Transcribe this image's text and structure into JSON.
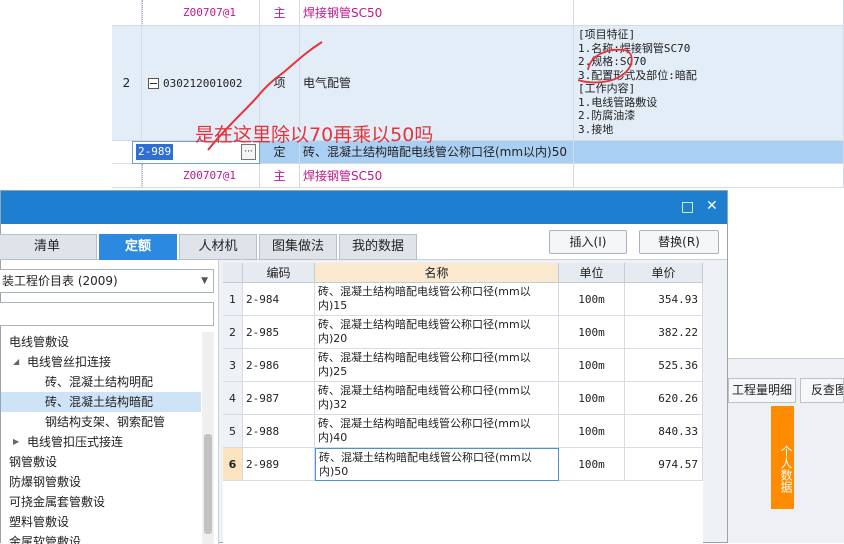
{
  "top_table": {
    "row_material_1": {
      "code": "Z00707@1",
      "type": "主",
      "name": "焊接钢管SC50"
    },
    "row_item": {
      "index": "2",
      "code": "030212001002",
      "type": "项",
      "name": "电气配管",
      "features": "[项目特征]\n1.名称:焊接钢管SC70\n2.规格:SC70\n3.配置形式及部位:暗配\n[工作内容]\n1.电线管路敷设\n2.防腐油漆\n3.接地"
    },
    "row_quota": {
      "code": "2-989",
      "more_label": "···",
      "type": "定",
      "name": "砖、混凝土结构暗配电线管公称口径(mm以内)50"
    },
    "row_material_2": {
      "code": "Z00707@1",
      "type": "主",
      "name": "焊接钢管SC50"
    }
  },
  "annotation": "是在这里除以70再乘以50吗",
  "dialog": {
    "titlebar": {
      "restore_icon": "□",
      "close_icon": "✕"
    },
    "tabs": [
      {
        "label": "清单"
      },
      {
        "label": "定额"
      },
      {
        "label": "人材机"
      },
      {
        "label": "图集做法"
      },
      {
        "label": "我的数据"
      }
    ],
    "buttons": {
      "insert": "插入(I)",
      "replace": "替换(R)"
    },
    "catalog_select": "装工程价目表 (2009)",
    "tree": [
      {
        "label": "电线管敷设",
        "level": 0,
        "arrow": ""
      },
      {
        "label": "电线管丝扣连接",
        "level": 1,
        "arrow": "◢"
      },
      {
        "label": "砖、混凝土结构明配",
        "level": 2,
        "arrow": ""
      },
      {
        "label": "砖、混凝土结构暗配",
        "level": 2,
        "arrow": "",
        "selected": true
      },
      {
        "label": "钢结构支架、钢索配管",
        "level": 2,
        "arrow": ""
      },
      {
        "label": "电线管扣压式接连",
        "level": 1,
        "arrow": "▶"
      },
      {
        "label": "钢管敷设",
        "level": 0,
        "arrow": ""
      },
      {
        "label": "防爆钢管敷设",
        "level": 0,
        "arrow": ""
      },
      {
        "label": "可挠金属套管敷设",
        "level": 0,
        "arrow": ""
      },
      {
        "label": "塑料管敷设",
        "level": 0,
        "arrow": ""
      },
      {
        "label": "金属软管敷设",
        "level": 0,
        "arrow": ""
      }
    ],
    "grid": {
      "headers": {
        "code": "编码",
        "name": "名称",
        "unit": "单位",
        "price": "单价"
      },
      "rows": [
        {
          "idx": "1",
          "code": "2-984",
          "name": "砖、混凝土结构暗配电线管公称口径(mm以内)15",
          "unit": "100m",
          "price": "354.93"
        },
        {
          "idx": "2",
          "code": "2-985",
          "name": "砖、混凝土结构暗配电线管公称口径(mm以内)20",
          "unit": "100m",
          "price": "382.22"
        },
        {
          "idx": "3",
          "code": "2-986",
          "name": "砖、混凝土结构暗配电线管公称口径(mm以内)25",
          "unit": "100m",
          "price": "525.36"
        },
        {
          "idx": "4",
          "code": "2-987",
          "name": "砖、混凝土结构暗配电线管公称口径(mm以内)32",
          "unit": "100m",
          "price": "620.26"
        },
        {
          "idx": "5",
          "code": "2-988",
          "name": "砖、混凝土结构暗配电线管公称口径(mm以内)40",
          "unit": "100m",
          "price": "840.33"
        },
        {
          "idx": "6",
          "code": "2-989",
          "name": "砖、混凝土结构暗配电线管公称口径(mm以内)50",
          "unit": "100m",
          "price": "974.57",
          "selected": true
        }
      ]
    }
  },
  "right_panel": {
    "tab_quantity": "工程量明细",
    "tab_reverse": "反查图",
    "side_button": "个人数据"
  },
  "colors": {
    "accent": "#2b8ae0",
    "selected_row": "#a9cff2",
    "annotation": "#e8323a",
    "side_button": "#ff8c00"
  }
}
